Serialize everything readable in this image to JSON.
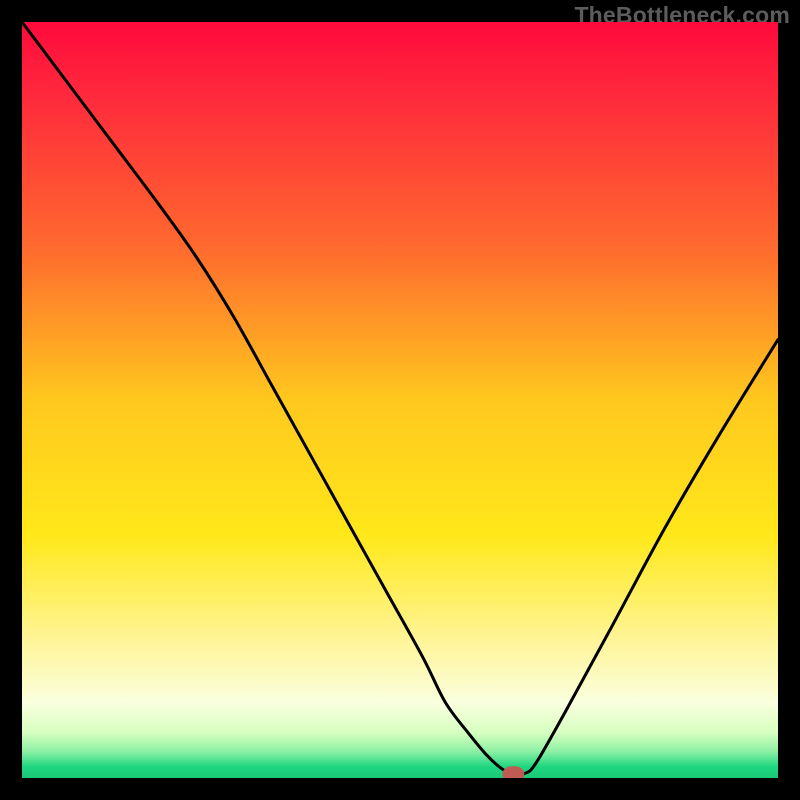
{
  "watermark": "TheBottleneck.com",
  "chart_data": {
    "type": "line",
    "title": "",
    "xlabel": "",
    "ylabel": "",
    "xlim": [
      0,
      100
    ],
    "ylim": [
      0,
      100
    ],
    "gradient_stops": [
      {
        "offset": 0,
        "color": "#ff0a3c"
      },
      {
        "offset": 0.1,
        "color": "#ff2a3c"
      },
      {
        "offset": 0.3,
        "color": "#ff6a2e"
      },
      {
        "offset": 0.5,
        "color": "#ffc81e"
      },
      {
        "offset": 0.68,
        "color": "#ffe81a"
      },
      {
        "offset": 0.82,
        "color": "#fff59a"
      },
      {
        "offset": 0.9,
        "color": "#faffde"
      },
      {
        "offset": 0.94,
        "color": "#d6ffc0"
      },
      {
        "offset": 0.965,
        "color": "#8cf0a4"
      },
      {
        "offset": 0.985,
        "color": "#1fd680"
      },
      {
        "offset": 1.0,
        "color": "#18c876"
      }
    ],
    "series": [
      {
        "name": "curve",
        "x": [
          0,
          6,
          12,
          18,
          23,
          28,
          33,
          38,
          43,
          48,
          53,
          56,
          59,
          61.5,
          63.5,
          65,
          66.5,
          68,
          72,
          78,
          85,
          92,
          100
        ],
        "y": [
          100,
          92,
          84,
          76,
          69,
          61,
          52,
          43,
          34,
          25,
          16,
          10,
          6,
          3,
          1.2,
          0.5,
          0.6,
          2,
          9,
          20,
          33,
          45,
          58
        ]
      }
    ],
    "marker": {
      "x": 65,
      "y": 0.5,
      "color": "#c05a55"
    }
  }
}
